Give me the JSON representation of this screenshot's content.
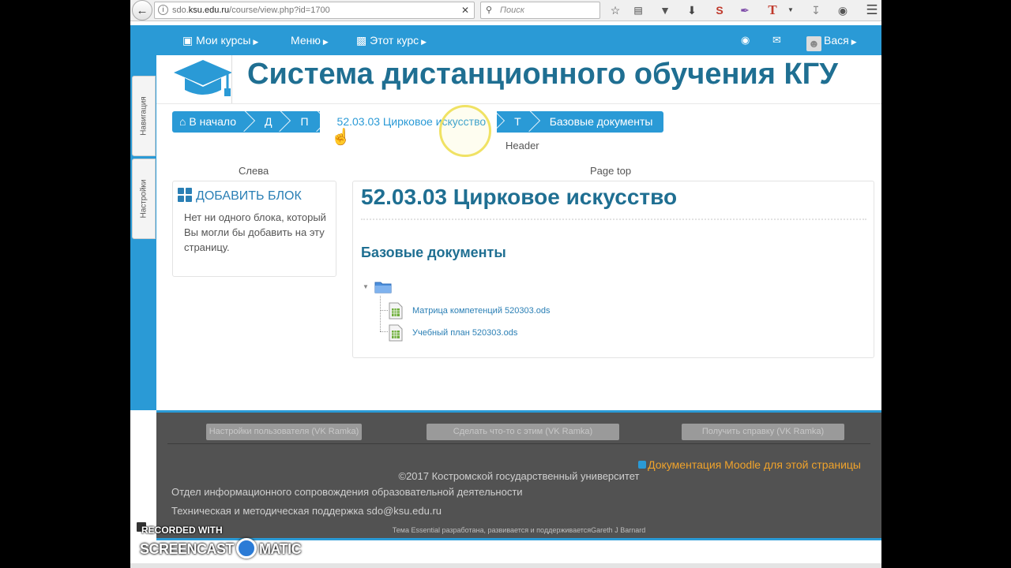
{
  "browser": {
    "url_prefix": "sdo.",
    "url_host": "ksu.edu.ru",
    "url_path": "/course/view.php?id=1700",
    "search_placeholder": "Поиск",
    "icons": [
      "bookmark-star-icon",
      "reading-list-icon",
      "pocket-icon",
      "download-icon",
      "extension-s-icon",
      "pen-icon",
      "font-t-icon",
      "dropdown-icon",
      "download-arrow-icon",
      "globe-icon",
      "menu-icon"
    ]
  },
  "navbar": {
    "my_courses": "Мои курсы",
    "menu": "Меню",
    "this_course": "Этот курс",
    "user_name": "Вася"
  },
  "side_tabs": {
    "navigation": "Навигация",
    "settings": "Настройки"
  },
  "header": {
    "site_title": "Система дистанционного обучения КГУ",
    "region_label": "Header"
  },
  "breadcrumb": [
    "В начало",
    "Д",
    "П",
    "52.03.03 Цирковое искусство",
    "Т",
    "Базовые документы"
  ],
  "left_region": {
    "label": "Слева",
    "block_title": "ДОБАВИТЬ БЛОК",
    "block_text": "Нет ни одного блока, который Вы могли бы добавить на эту страницу."
  },
  "main": {
    "region_label": "Page top",
    "course_title": "52.03.03 Цирковое искусство",
    "section_title": "Базовые документы",
    "files": [
      "Матрица компетенций 520303.ods",
      "Учебный план 520303.ods"
    ]
  },
  "footer": {
    "buttons": [
      "Настройки пользователя (VK Ramka)",
      "Сделать что-то с этим (VK Ramka)",
      "Получить справку (VK Ramka)"
    ],
    "moodle_docs": "Документация Moodle для этой страницы",
    "copyright": "©2017 Костромской государственный университет",
    "department": "Отдел информационного сопровождения образовательной деятельности",
    "support": "Техническая и методическая поддержка sdo@ksu.edu.ru",
    "theme_credit": "Тема Essential разработана, развивается и поддерживаетсяGareth J Barnard"
  },
  "watermark": {
    "recorded_with": "RECORDED WITH",
    "brand_left": "SCREENCAST",
    "brand_right": "MATIC"
  },
  "colors": {
    "accent": "#2a9ad6",
    "title": "#1f6f92",
    "footer_bg": "#525252",
    "doc_link": "#f0a32b"
  }
}
